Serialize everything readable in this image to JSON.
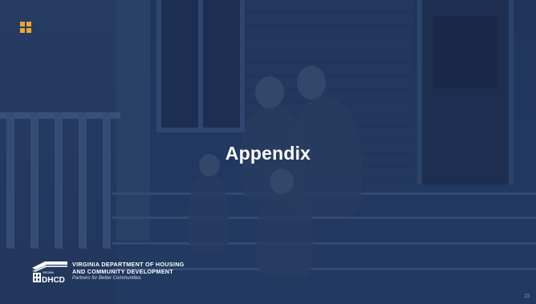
{
  "slide": {
    "title": "Appendix",
    "page_number": "23"
  },
  "footer": {
    "agency_line1": "VIRGINIA DEPARTMENT OF HOUSING",
    "agency_line2": "AND COMMUNITY DEVELOPMENT",
    "tagline": "Partners for Better Communities",
    "logo_small_text": "VIRGINIA",
    "logo_acronym": "DHCD"
  },
  "colors": {
    "overlay": "#223a63",
    "accent": "#f0a52c",
    "text": "#ffffff"
  },
  "icons": [
    "grid-icon",
    "dhcd-house-logo-icon"
  ]
}
